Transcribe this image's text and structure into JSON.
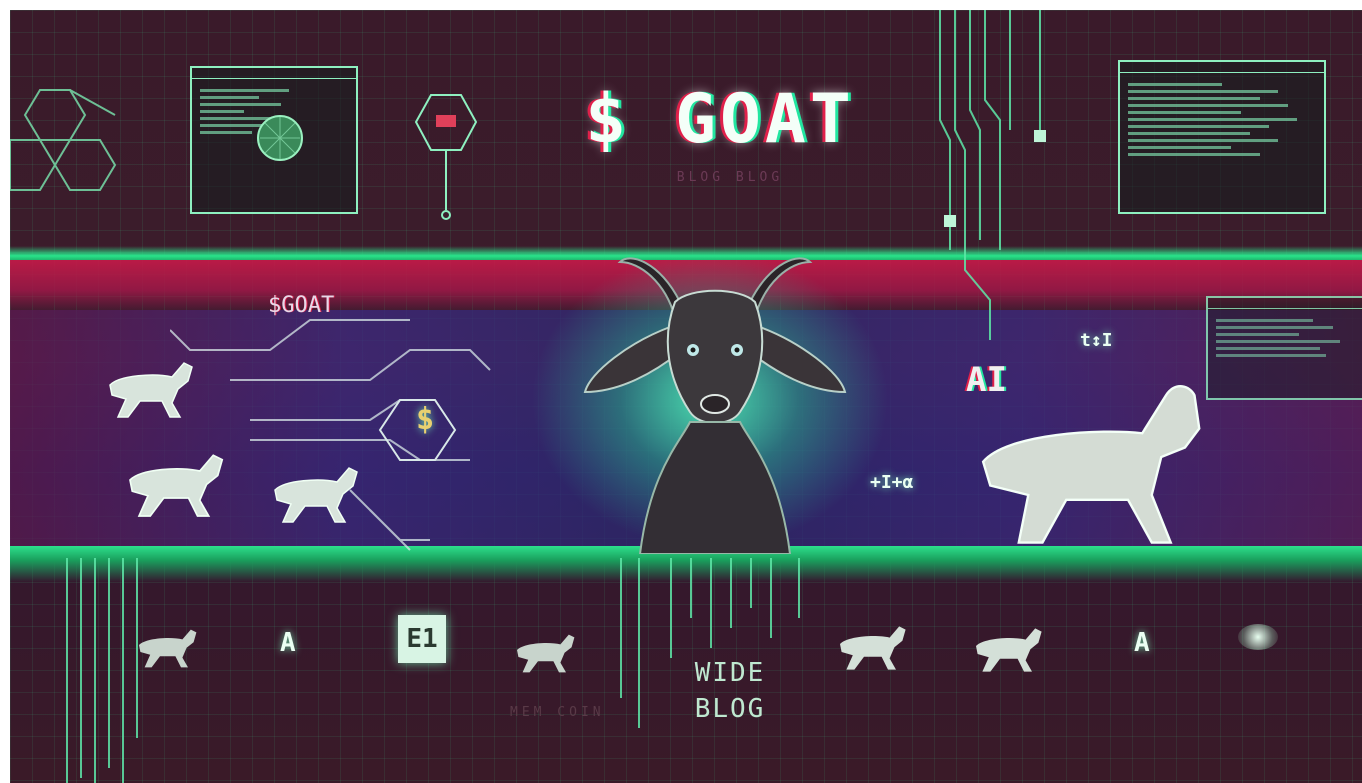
{
  "banner": {
    "title": "$ GOAT",
    "subtitle": "BLOG   BLOG",
    "label_goat": "$GOAT",
    "label_ai": "AI",
    "label_wide": "WIDE",
    "label_blog": "BLOG",
    "label_memecoin": "MEM   COIN",
    "glyph_dollar": "$",
    "glyph_a1": "A",
    "glyph_a2": "A",
    "glyph_box": "E1",
    "glyph_t1": "t↕I",
    "glyph_t2": "+I+α"
  },
  "colors": {
    "accent_green": "#29e38a",
    "accent_red": "#d01a4a",
    "background": "#3a1a2a"
  },
  "icons": [
    "goat-portrait",
    "goat-running",
    "circuit-hexagon",
    "terminal-window"
  ]
}
